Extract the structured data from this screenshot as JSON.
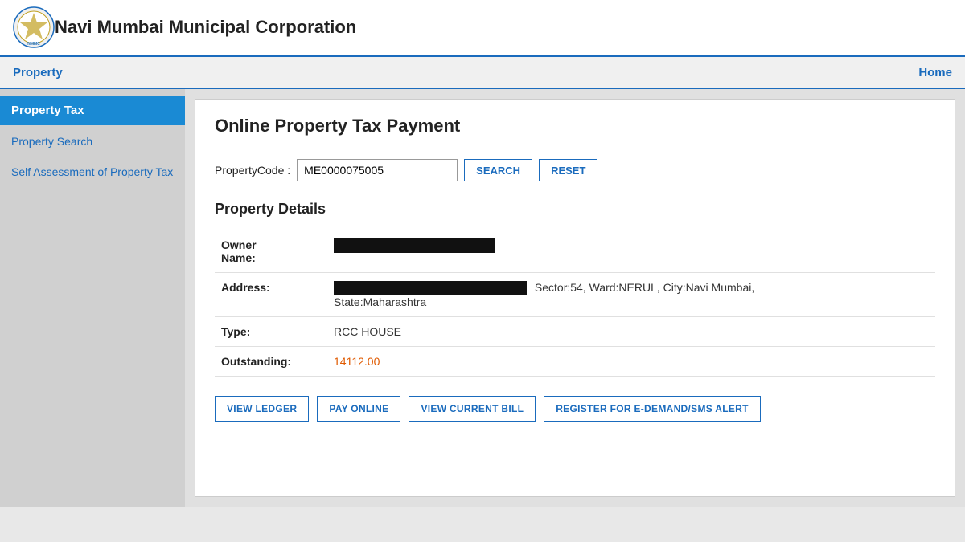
{
  "header": {
    "title": "Navi Mumbai Municipal Corporation",
    "logo_alt": "NMMC Logo"
  },
  "navbar": {
    "left_label": "Property",
    "right_label": "Home"
  },
  "sidebar": {
    "active_item": "Property Tax",
    "items": [
      {
        "label": "Property Search",
        "id": "property-search"
      },
      {
        "label": "Self Assessment of Property Tax",
        "id": "self-assessment"
      }
    ]
  },
  "content": {
    "title": "Online Property Tax Payment",
    "search": {
      "label": "PropertyCode :",
      "input_value": "ME0000075005",
      "search_button": "SEARCH",
      "reset_button": "RESET"
    },
    "property_details": {
      "section_title": "Property Details",
      "owner_name_label": "Owner\nName:",
      "address_label": "Address:",
      "address_value": "Sector:54, Ward:NERUL, City:Navi Mumbai, State:Maharashtra",
      "type_label": "Type:",
      "type_value": "RCC HOUSE",
      "outstanding_label": "Outstanding:",
      "outstanding_value": "14112.00"
    },
    "action_buttons": [
      "VIEW LEDGER",
      "PAY ONLINE",
      "VIEW CURRENT BILL",
      "REGISTER FOR E-DEMAND/SMS ALERT"
    ]
  }
}
